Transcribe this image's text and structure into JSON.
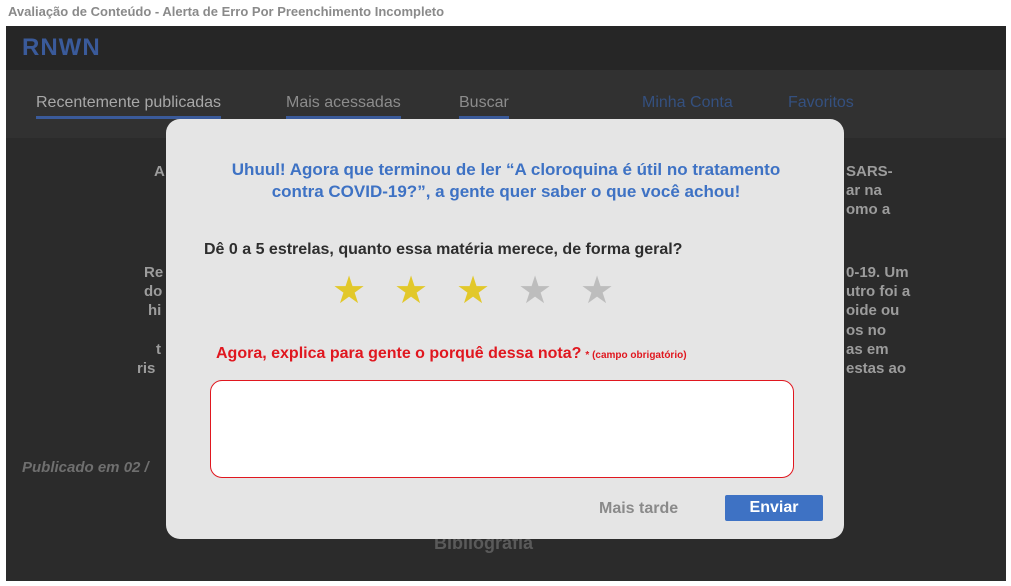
{
  "frame_title": "Avaliação de Conteúdo - Alerta de Erro Por Preenchimento Incompleto",
  "app": {
    "logo": "RNWN"
  },
  "nav": {
    "tabs": [
      "Recentemente publicadas",
      "Mais acessadas",
      "Buscar"
    ],
    "links": [
      "Minha Conta",
      "Favoritos"
    ]
  },
  "article": {
    "fragments_left": [
      "A",
      "Re",
      "do",
      "hi",
      "t",
      "ris"
    ],
    "fragments_right": [
      "SARS-",
      "ar na",
      "omo a",
      "0-19. Um",
      "utro foi a",
      "oide ou",
      "os no",
      "as em",
      "estas ao"
    ],
    "published": "Publicado em 02 /",
    "bibliography": "Bibliografia"
  },
  "modal": {
    "intro_line1": "Uhuul! Agora que terminou de ler “A cloroquina é útil no tratamento",
    "intro_line2": "contra COVID-19?”, a gente quer saber o que você achou!",
    "question": "Dê 0 a 5 estrelas, quanto essa matéria merece, de forma geral?",
    "rating": {
      "value": 3,
      "max": 5,
      "star_glyph": "★",
      "on_color": "#e2c82a",
      "off_color": "#bdbdbd"
    },
    "explain_label": "Agora, explica para gente o porquê dessa nota?",
    "required_note": "* (campo obrigatório)",
    "comment_value": "",
    "later_button": "Mais tarde",
    "send_button": "Enviar",
    "error_color": "#e0171f",
    "accent_color": "#3e72c4"
  }
}
